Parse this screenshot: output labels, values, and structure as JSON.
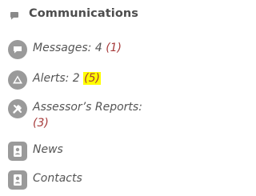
{
  "panel": {
    "title": "Communications",
    "items": [
      {
        "label": "Messages: 4",
        "badge": "(1)",
        "icon": "chat-bubble-icon"
      },
      {
        "label": "Alerts: 2",
        "badge": "(5)",
        "icon": "warning-triangle-icon"
      },
      {
        "label": "Assessor’s Reports:",
        "badge": "(3)",
        "icon": "wrench-icon"
      },
      {
        "label": "News",
        "icon": "contact-card-icon"
      },
      {
        "label": "Contacts",
        "icon": "contact-card-icon"
      }
    ]
  },
  "colors": {
    "accent_red": "#a63a3a",
    "icon_grey": "#9a9a9a",
    "text": "#555555",
    "highlight": "#ffff00"
  }
}
